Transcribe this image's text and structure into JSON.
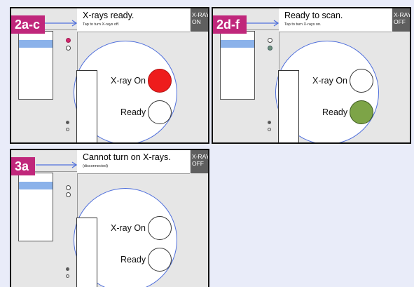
{
  "colors": {
    "background": "#e9ecf9",
    "badge": "#c0277b",
    "accent_blue": "#4f6fdc",
    "xray_on_red": "#ee1c1c",
    "ready_green": "#7da447",
    "indicator_blue": "#8bb2ea",
    "button_gray": "#5f5f5f"
  },
  "panels": [
    {
      "step": "2a-c",
      "notification": {
        "title": "X-rays ready.",
        "subtitle": "Tap to turn X-rays off."
      },
      "xray_button": "X-RAY\nON",
      "xray_on_label": "X-ray On",
      "ready_label": "Ready",
      "xray_on_state": "on",
      "ready_state": "off"
    },
    {
      "step": "2d-f",
      "notification": {
        "title": "Ready to scan.",
        "subtitle": "Tap to turn X-rays on."
      },
      "xray_button": "X-RAY\nOFF",
      "xray_on_label": "X-ray On",
      "ready_label": "Ready",
      "xray_on_state": "off",
      "ready_state": "on"
    },
    {
      "step": "3a",
      "notification": {
        "title": "Cannot turn on X-rays.",
        "subtitle": "(disconnected)"
      },
      "xray_button": "X-RAY\nOFF",
      "xray_on_label": "X-ray On",
      "ready_label": "Ready",
      "xray_on_state": "off",
      "ready_state": "off"
    }
  ]
}
